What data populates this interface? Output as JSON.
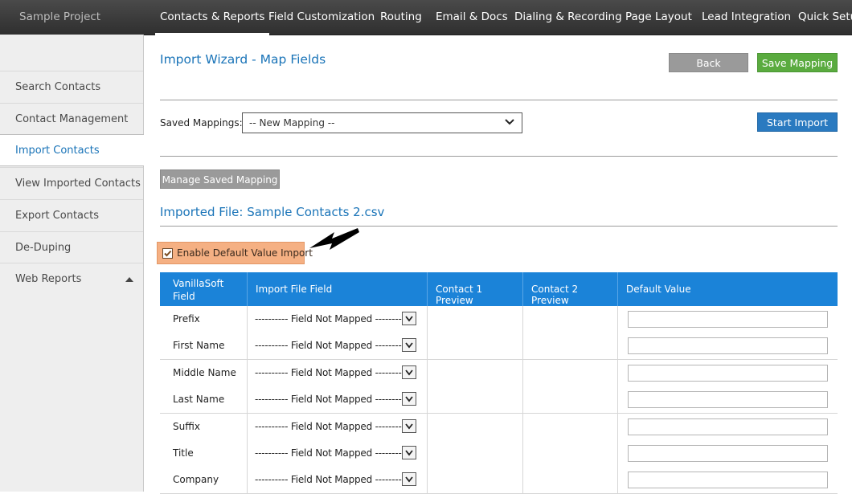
{
  "topbar": {
    "project": "Sample Project",
    "tabs": [
      {
        "label": "Contacts & Reports",
        "active": true
      },
      {
        "label": "Field Customization"
      },
      {
        "label": "Routing"
      },
      {
        "label": "Email & Docs"
      },
      {
        "label": "Dialing & Recording"
      },
      {
        "label": "Page Layout"
      },
      {
        "label": "Lead Integration"
      },
      {
        "label": "Quick Setup"
      }
    ]
  },
  "sidebar": {
    "items": [
      {
        "label": "Search Contacts"
      },
      {
        "label": "Contact Management"
      },
      {
        "label": "Import Contacts",
        "active": true
      },
      {
        "label": "View Imported Contacts"
      },
      {
        "label": "Export Contacts"
      },
      {
        "label": "De-Duping"
      },
      {
        "label": "Web Reports",
        "icon": "triangle-up-icon"
      }
    ]
  },
  "main": {
    "title": "Import Wizard - Map Fields",
    "back_label": "Back",
    "save_mapping_label": "Save Mapping",
    "saved_mappings_label": "Saved Mappings:",
    "saved_mappings_value": "-- New Mapping --",
    "start_import_label": "Start Import",
    "manage_label": "Manage Saved Mapping",
    "imported_file": "Imported File: Sample Contacts 2.csv",
    "enable_default_label": "Enable Default Value Import",
    "enable_default_checked": true
  },
  "table": {
    "headers": {
      "field": "VanillaSoft Field",
      "import": "Import File Field",
      "c1": "Contact 1 Preview",
      "c2": "Contact 2 Preview",
      "default": "Default Value"
    },
    "not_mapped": "---------- Field Not Mapped ----------",
    "rows": [
      "Prefix",
      "First Name",
      "Middle Name",
      "Last Name",
      "Suffix",
      "Title",
      "Company"
    ]
  },
  "colors": {
    "accent_blue": "#1a74b8",
    "header_blue": "#1b83d8",
    "save_green": "#5aab3f",
    "highlight_orange": "#f5b083"
  }
}
